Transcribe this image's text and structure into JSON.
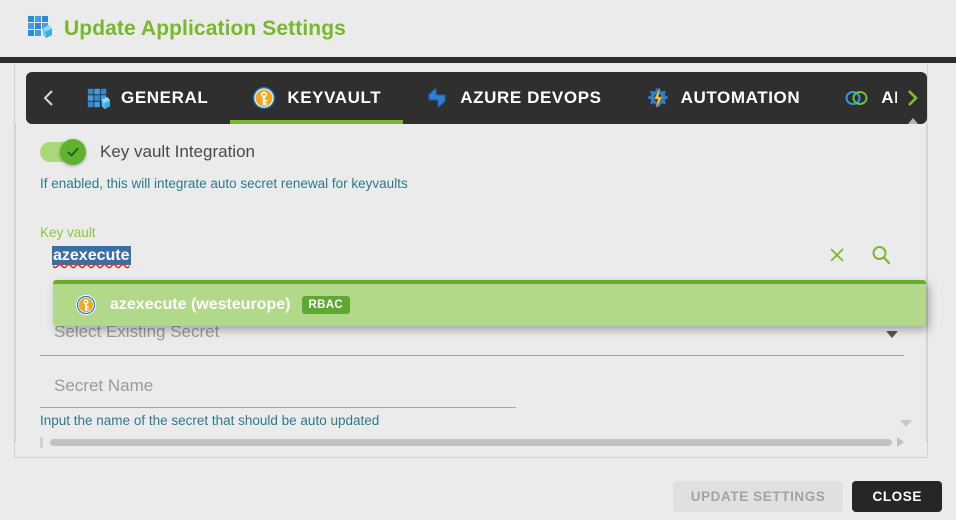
{
  "window": {
    "title": "Update Application Settings",
    "title_icon": "app-grid-cube-icon",
    "title_color": "#78b82a"
  },
  "tabbar": {
    "scroll_left_icon": "chevron-left-icon",
    "scroll_right_icon": "chevron-right-icon",
    "active_tab": "KEYVAULT",
    "active_underline_color": "#76b729",
    "background": "#2f2f2f",
    "tabs": [
      {
        "label": "GENERAL",
        "icon": "app-grid-cube-icon",
        "active": false
      },
      {
        "label": "KEYVAULT",
        "icon": "key-circle-icon",
        "active": true
      },
      {
        "label": "AZURE DEVOPS",
        "icon": "azure-devops-icon",
        "active": false
      },
      {
        "label": "AUTOMATION",
        "icon": "gear-lightning-icon",
        "active": false
      },
      {
        "label": "API CON",
        "icon": "api-connection-rings-icon",
        "active": false
      }
    ]
  },
  "keyvault_panel": {
    "toggle": {
      "label": "Key vault Integration",
      "checked": true,
      "icon": "check-icon",
      "track_color": "#a8d878",
      "knob_color": "#5eb22e"
    },
    "toggle_hint": "If enabled, this will integrate auto secret renewal for keyvaults",
    "keyvault_field": {
      "label": "Key vault",
      "label_color": "#8cc63f",
      "value": "azexecute",
      "value_selected": true,
      "spellcheck_underline": true,
      "clear_icon": "close-x-icon",
      "search_icon": "search-icon",
      "icon_color": "#7cb82f"
    },
    "dropdown": {
      "visible": true,
      "background": "#b2d989",
      "top_border_color": "#6aab28",
      "options": [
        {
          "icon": "key-circle-icon",
          "label": "azexecute (westeurope)",
          "badge": "RBAC",
          "badge_color": "#5fa832",
          "highlighted": true
        }
      ]
    },
    "select_existing_secret": {
      "placeholder": "Select Existing Secret",
      "value": "",
      "caret_icon": "caret-down-icon"
    },
    "secret_name": {
      "placeholder": "Secret Name",
      "value": "",
      "hint": "Input the name of the secret that should be auto updated"
    },
    "scroll": {
      "down_indicator_icon": "caret-down-icon",
      "h_scroll_right_icon": "caret-right-icon"
    }
  },
  "footer": {
    "update_label": "UPDATE SETTINGS",
    "update_disabled": true,
    "close_label": "CLOSE",
    "close_bg": "#262626"
  }
}
